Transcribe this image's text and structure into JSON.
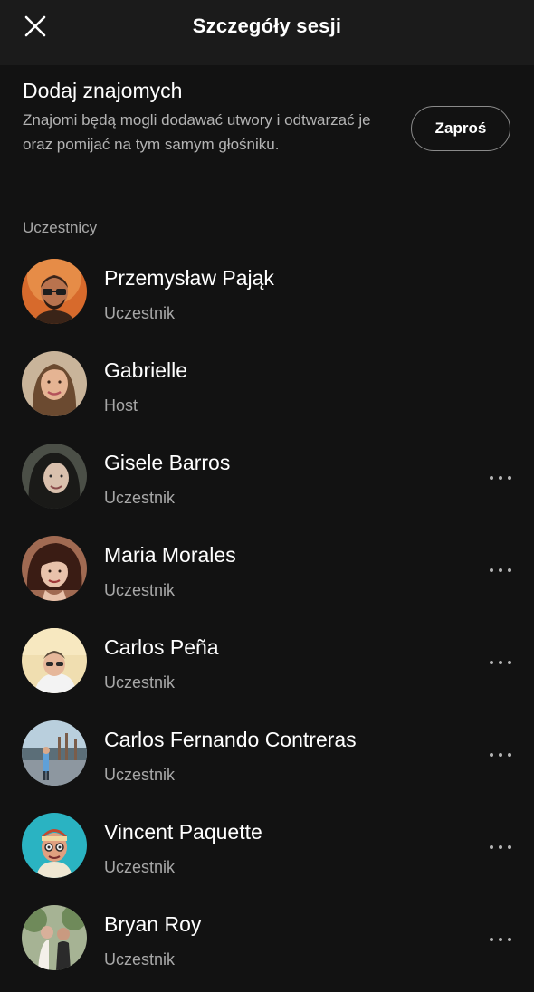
{
  "header": {
    "title": "Szczegóły sesji",
    "close_icon": "close-icon"
  },
  "invite": {
    "title": "Dodaj znajomych",
    "description": "Znajomi będą mogli dodawać utwory i odtwarzać je oraz pomijać na tym samym głośniku.",
    "button_label": "Zaproś"
  },
  "participants_section": {
    "label": "Uczestnicy"
  },
  "participants": [
    {
      "name": "Przemysław Pająk",
      "role": "Uczestnik",
      "has_menu": false,
      "avatar_color": "#c4622d"
    },
    {
      "name": "Gabrielle",
      "role": "Host",
      "has_menu": false,
      "avatar_color": "#c9a886"
    },
    {
      "name": "Gisele Barros",
      "role": "Uczestnik",
      "has_menu": true,
      "avatar_color": "#3b3b36"
    },
    {
      "name": "Maria Morales",
      "role": "Uczestnik",
      "has_menu": true,
      "avatar_color": "#8a5a48"
    },
    {
      "name": "Carlos Peña",
      "role": "Uczestnik",
      "has_menu": true,
      "avatar_color": "#e8d9a6"
    },
    {
      "name": "Carlos Fernando Contreras",
      "role": "Uczestnik",
      "has_menu": true,
      "avatar_color": "#9fb6c6"
    },
    {
      "name": "Vincent Paquette",
      "role": "Uczestnik",
      "has_menu": true,
      "avatar_color": "#2ab3c2"
    },
    {
      "name": "Bryan Roy",
      "role": "Uczestnik",
      "has_menu": true,
      "avatar_color": "#8e9a7c"
    }
  ],
  "colors": {
    "background": "#121212",
    "header_background": "#1b1b1b",
    "secondary_text": "#a7a7a7"
  }
}
